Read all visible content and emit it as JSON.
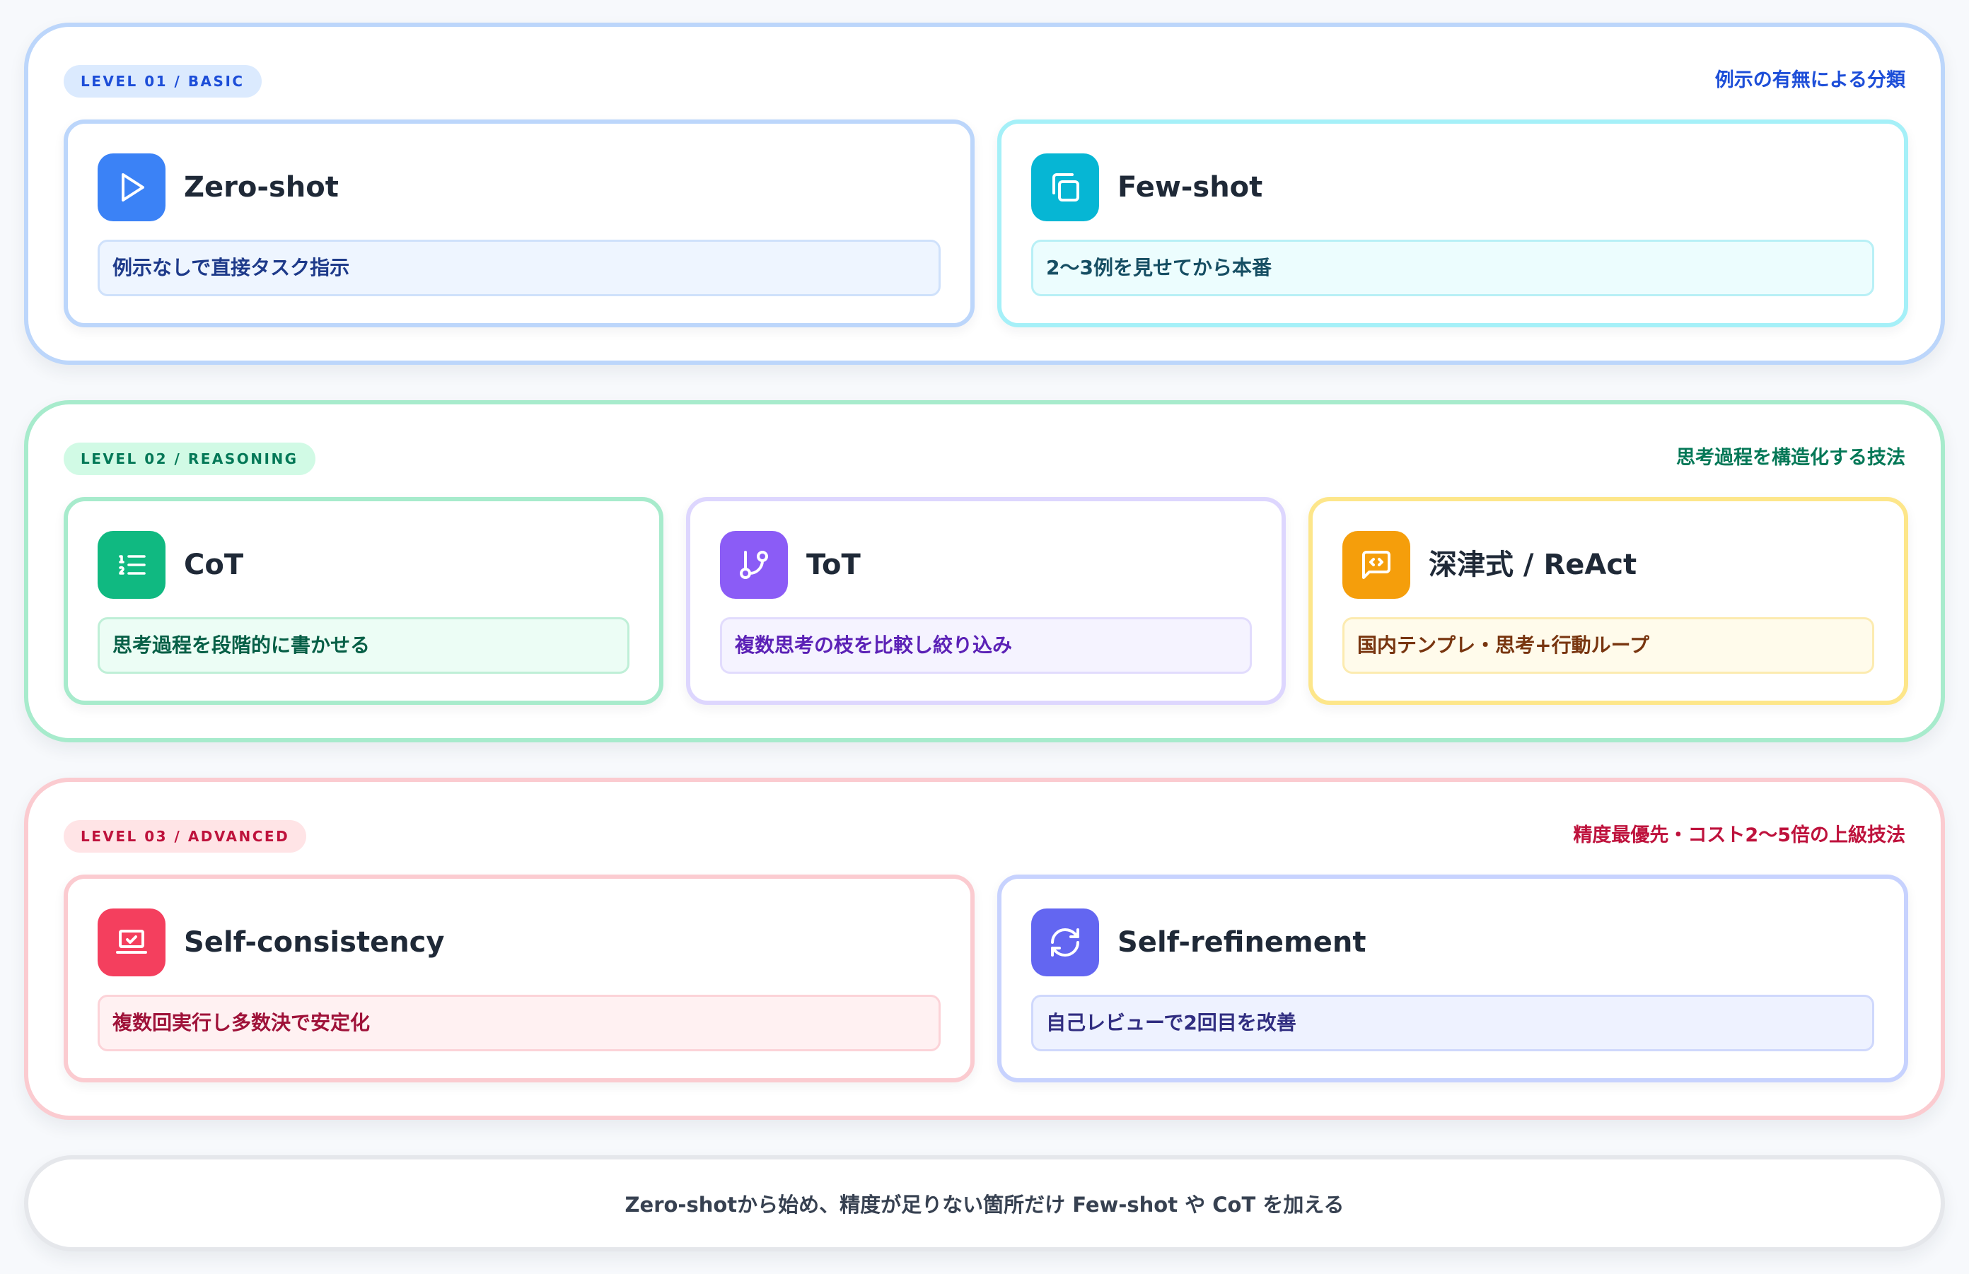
{
  "levels": [
    {
      "badge": "LEVEL 01 / BASIC",
      "caption": "例示の有無による分類",
      "cards": [
        {
          "title": "Zero-shot",
          "description": "例示なしで直接タスク指示",
          "icon": "play-icon",
          "color": "#3b82f6"
        },
        {
          "title": "Few-shot",
          "description": "2〜3例を見せてから本番",
          "icon": "copy-icon",
          "color": "#06b6d4"
        }
      ]
    },
    {
      "badge": "LEVEL 02 / REASONING",
      "caption": "思考過程を構造化する技法",
      "cards": [
        {
          "title": "CoT",
          "description": "思考過程を段階的に書かせる",
          "icon": "numbered-list-icon",
          "color": "#10b981"
        },
        {
          "title": "ToT",
          "description": "複数思考の枝を比較し絞り込み",
          "icon": "git-branch-icon",
          "color": "#8b5cf6"
        },
        {
          "title": "深津式 / ReAct",
          "description": "国内テンプレ・思考+行動ループ",
          "icon": "message-code-icon",
          "color": "#f59e0b"
        }
      ]
    },
    {
      "badge": "LEVEL 03 / ADVANCED",
      "caption": "精度最優先・コスト2〜5倍の上級技法",
      "cards": [
        {
          "title": "Self-consistency",
          "description": "複数回実行し多数決で安定化",
          "icon": "laptop-check-icon",
          "color": "#f43f5e"
        },
        {
          "title": "Self-refinement",
          "description": "自己レビューで2回目を改善",
          "icon": "refresh-icon",
          "color": "#6366f1"
        }
      ]
    }
  ],
  "footer": {
    "text": "Zero-shotから始め、精度が足りない箇所だけ Few-shot や CoT を加える"
  }
}
